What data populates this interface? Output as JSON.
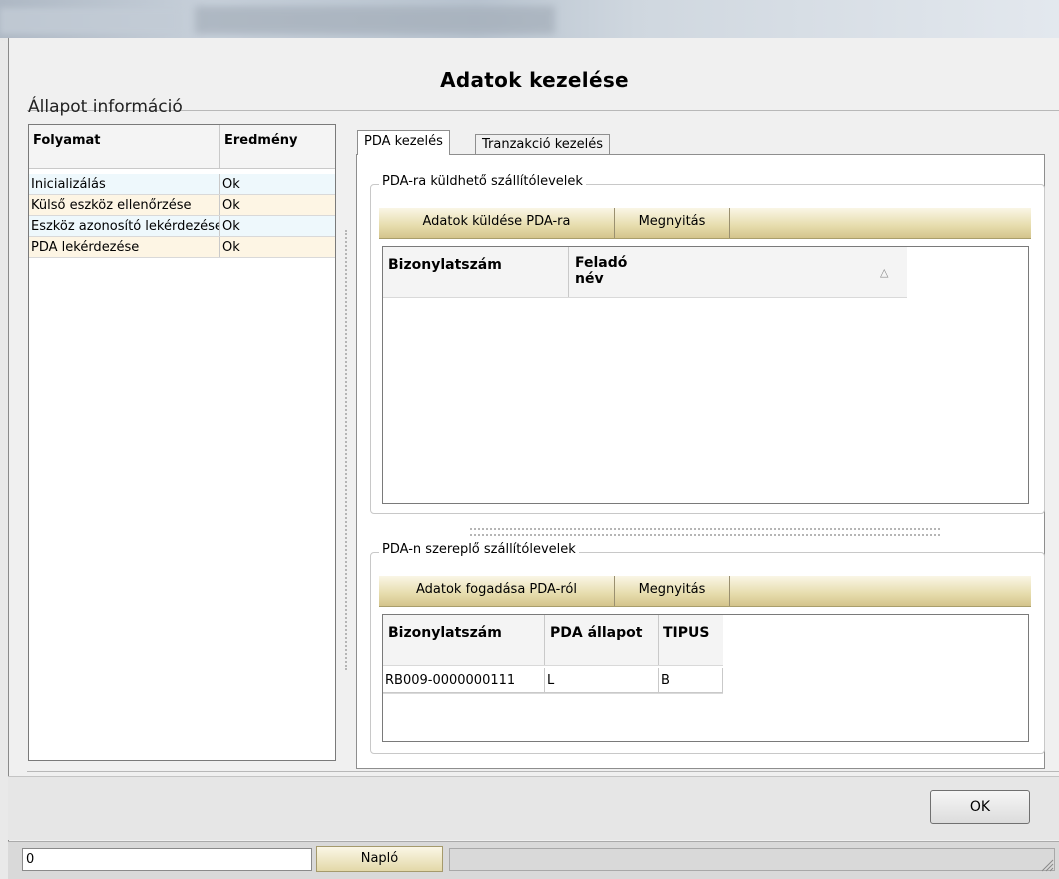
{
  "window": {
    "title": "Adatok kezelése"
  },
  "left_panel": {
    "title": "Állapot információ",
    "columns": [
      "Folyamat",
      "Eredmény"
    ],
    "rows": [
      {
        "process": "Inicializálás",
        "result": "Ok",
        "bg": "#eef8fc"
      },
      {
        "process": "Külső eszköz ellenőrzése",
        "result": "Ok",
        "bg": "#fdf5e4"
      },
      {
        "process": "Eszköz azonosító lekérdezése",
        "result": "Ok",
        "bg": "#eef8fc"
      },
      {
        "process": "PDA lekérdezése",
        "result": "Ok",
        "bg": "#fdf5e4"
      }
    ]
  },
  "tabs": [
    {
      "label": "PDA kezelés",
      "selected": true
    },
    {
      "label": "Tranzakció kezelés",
      "selected": false
    }
  ],
  "send_group": {
    "label": "PDA-ra küldhető szállítólevelek",
    "buttons": [
      "Adatok küldése PDA-ra",
      "Megnyitás"
    ],
    "columns": [
      "Bizonylatszám",
      "Feladó név"
    ],
    "sort_icon": "sort-triangle-icon",
    "rows": []
  },
  "recv_group": {
    "label": "PDA-n szereplő szállítólevelek",
    "buttons": [
      "Adatok fogadása PDA-ról",
      "Megnyitás"
    ],
    "columns": [
      "Bizonylatszám",
      "PDA állapot",
      "TIPUS"
    ],
    "rows": [
      {
        "doc_no": "RB009-0000000111",
        "status": "L",
        "type": "B"
      }
    ]
  },
  "footer": {
    "ok_label": "OK"
  },
  "status_bar": {
    "field_value": "0",
    "log_button": "Napló",
    "grip_icon": "resize-grip-icon"
  },
  "colors": {
    "toolbar": "#e6dcac",
    "row_blue": "#eef8fc",
    "row_beige": "#fdf5e4"
  }
}
